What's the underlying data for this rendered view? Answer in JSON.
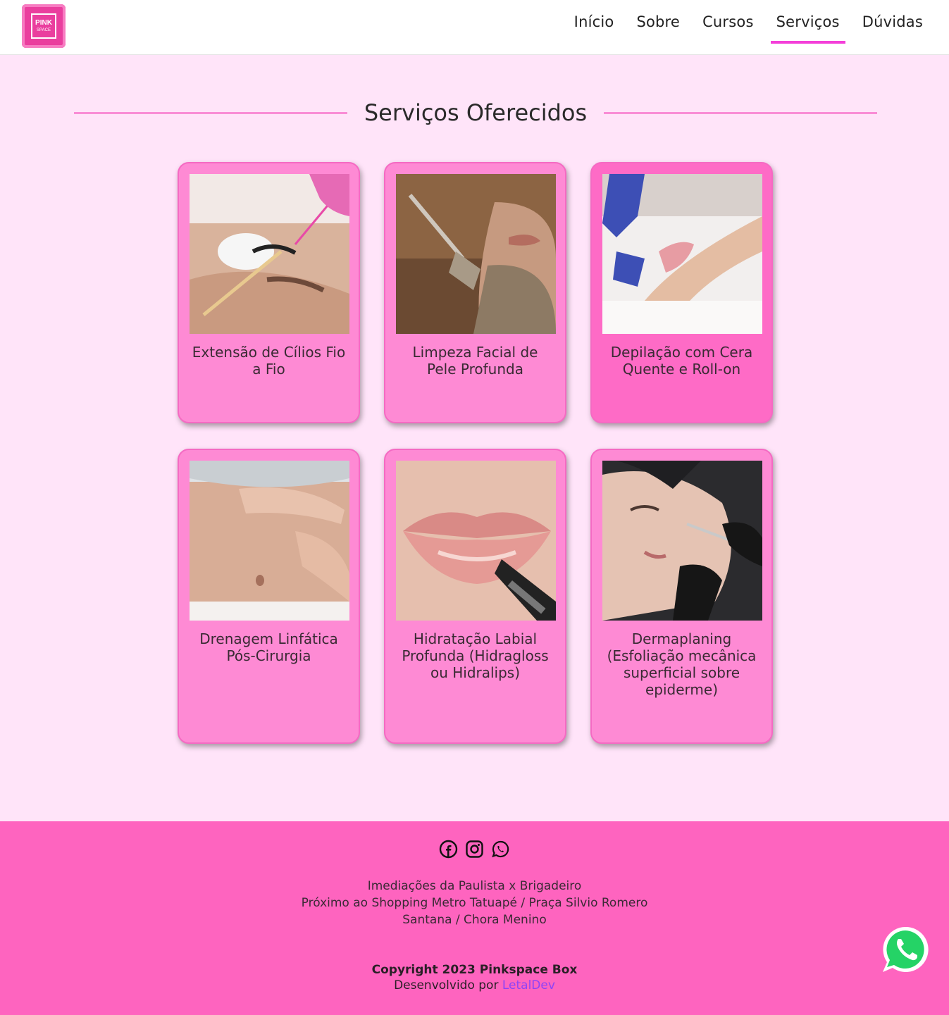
{
  "header": {
    "logo_text_top": "PINK",
    "logo_text_bottom": "SPACE",
    "nav": [
      {
        "label": "Início",
        "active": false
      },
      {
        "label": "Sobre",
        "active": false
      },
      {
        "label": "Cursos",
        "active": false
      },
      {
        "label": "Serviços",
        "active": true
      },
      {
        "label": "Dúvidas",
        "active": false
      }
    ]
  },
  "main": {
    "title": "Serviços Oferecidos",
    "services": [
      {
        "title": "Extensão de Cílios Fio a Fio",
        "image": "eyelash-extension-photo"
      },
      {
        "title": "Limpeza Facial de Pele Profunda",
        "image": "facial-mask-photo"
      },
      {
        "title": "Depilação com Cera Quente e Roll-on",
        "image": "waxing-photo"
      },
      {
        "title": "Drenagem Linfática Pós-Cirurgia",
        "image": "lymphatic-drainage-photo"
      },
      {
        "title": "Hidratação Labial Profunda (Hidragloss ou Hidralips)",
        "image": "lip-hydration-photo"
      },
      {
        "title": "Dermaplaning (Esfoliação mecânica superficial sobre epiderme)",
        "image": "dermaplaning-photo"
      }
    ]
  },
  "footer": {
    "socials": [
      "facebook-icon",
      "instagram-icon",
      "whatsapp-icon"
    ],
    "addresses": [
      "Imediações da Paulista x Brigadeiro",
      "Próximo ao Shopping Metro Tatuapé / Praça Silvio Romero",
      "Santana / Chora Menino"
    ],
    "copyright": "Copyright 2023 Pinkspace Box",
    "developed_by": "Desenvolvido por",
    "developer": "LetalDev"
  },
  "colors": {
    "background": "#ffe4f9",
    "card": "#fe8ad4",
    "footer": "#fe64bf",
    "accent": "#f43fd9",
    "link": "#8e44f5"
  }
}
